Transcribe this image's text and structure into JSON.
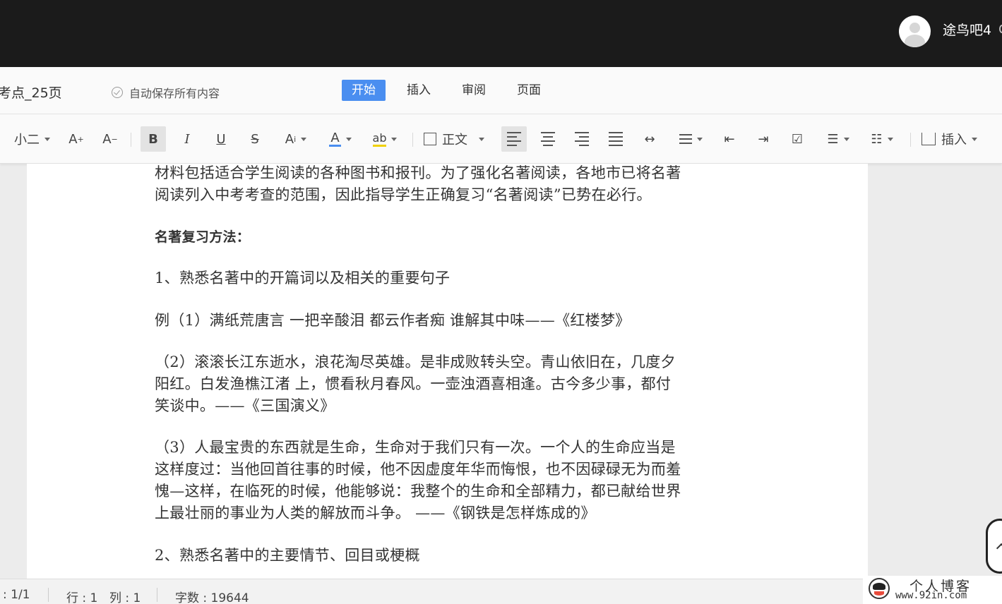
{
  "header": {
    "username": "途鸟吧4"
  },
  "menubar": {
    "doc_title": "考点_25页",
    "autosave": "自动保存所有内容",
    "tabs": [
      "开始",
      "插入",
      "审阅",
      "页面"
    ]
  },
  "toolbar": {
    "font_size": "小二",
    "style": "正文",
    "insert": "插入",
    "icons": [
      "font-increase-icon",
      "font-decrease-icon",
      "bold-icon",
      "italic-icon",
      "underline-icon",
      "strikethrough-icon",
      "superscript-icon",
      "font-color-icon",
      "highlight-icon",
      "paragraph-style-icon",
      "align-left-icon",
      "align-center-icon",
      "align-right-icon",
      "justify-icon",
      "distributed-icon",
      "line-spacing-icon",
      "outdent-icon",
      "indent-icon",
      "checkbox-icon",
      "bullet-list-icon",
      "numbered-list-icon",
      "insert-icon"
    ],
    "accent_color": "#4a8ef0"
  },
  "document": {
    "paragraphs": [
      "材料包括适合学生阅读的各种图书和报刊。为了强化名著阅读，各地市已将名著",
      "阅读列入中考考查的范围，因此指导学生正确复习“名著阅读”已势在必行。",
      "名著复习方法：",
      "1、熟悉名著中的开篇词以及相关的重要句子",
      "例（1）满纸荒唐言 一把辛酸泪 都云作者痴 谁解其中味——《红楼梦》",
      "（2）滚滚长江东逝水，浪花淘尽英雄。是非成败转头空。青山依旧在，几度夕",
      "阳红。白发渔樵江渚 上，惯看秋月春风。一壶浊酒喜相逢。古今多少事，都付",
      "笑谈中。——《三国演义》",
      "（3）人最宝贵的东西就是生命，生命对于我们只有一次。一个人的生命应当是",
      "这样度过：当他回首往事的时候，他不因虚度年华而悔恨，也不因碌碌无为而羞",
      "愧—这样，在临死的时候，他能够说：我整个的生命和全部精力，都已献给世界",
      "上最壮丽的事业为人类的解放而斗争。 ——《钢铁是怎样炼成的》",
      "2、熟悉名著中的主要情节、回目或梗概"
    ]
  },
  "statusbar": {
    "page": ": 1/1",
    "row": "行 : 1",
    "col": "列 : 1",
    "wordcount": "字数 : 19644"
  },
  "watermark": {
    "title": "个人博客",
    "url": "www.92in.com"
  }
}
